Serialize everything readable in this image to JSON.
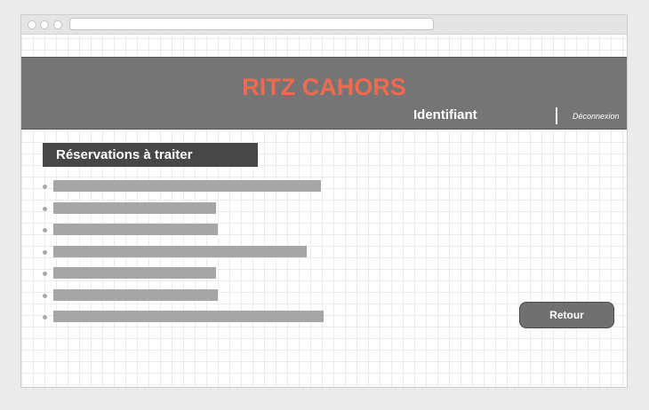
{
  "header": {
    "brand": "RITZ CAHORS",
    "user_label": "Identifiant",
    "logout_label": "Déconnexion"
  },
  "main": {
    "section_title": "Réservations à traiter",
    "back_button_label": "Retour"
  },
  "colors": {
    "brand": "#f06a50",
    "header_bg": "#757575",
    "section_title_bg": "#474747",
    "button_bg": "#707070"
  }
}
